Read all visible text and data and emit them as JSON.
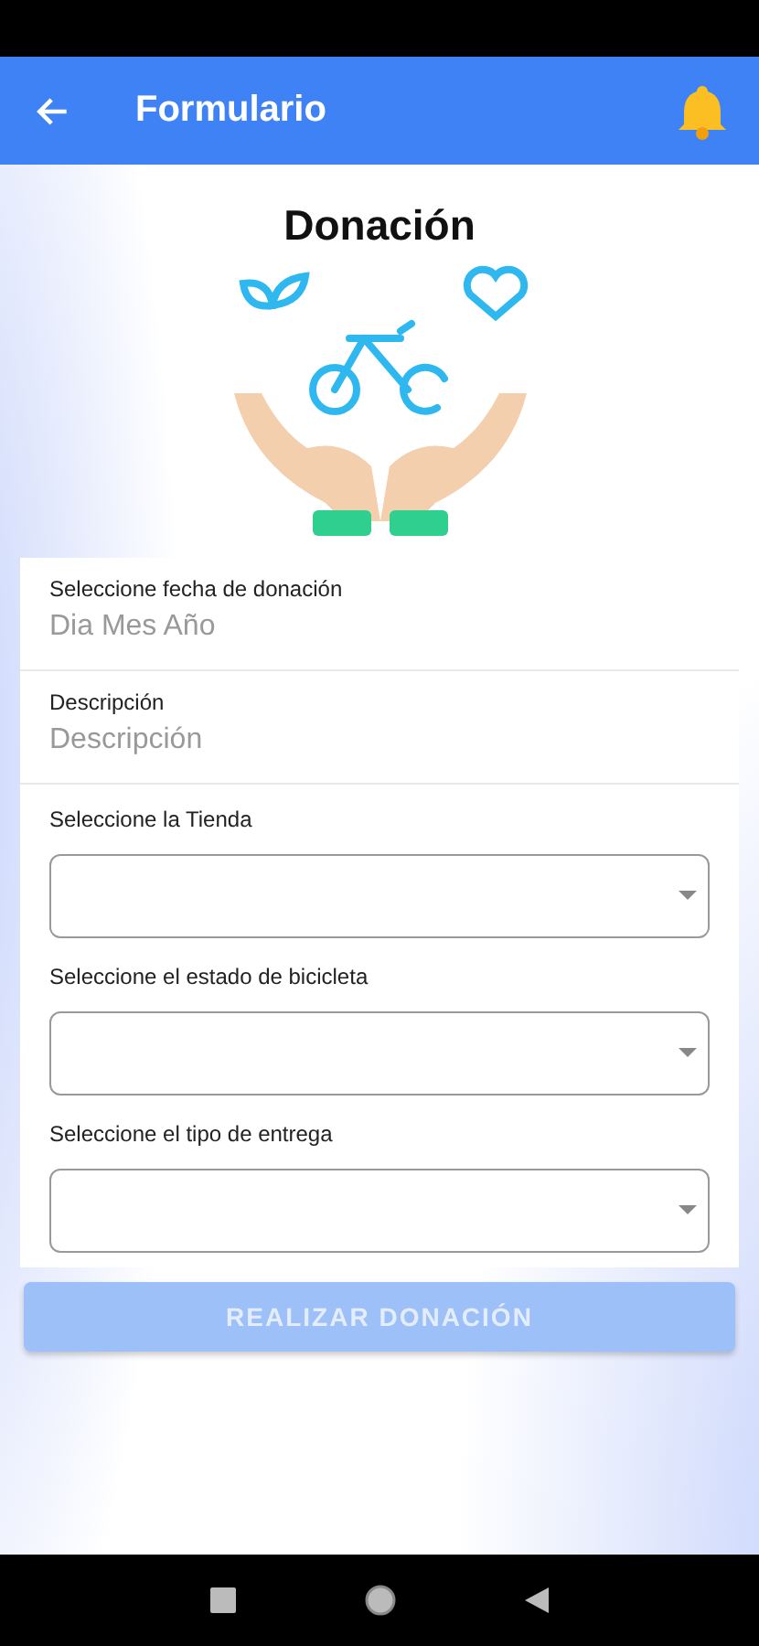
{
  "app_bar": {
    "title": "Formulario"
  },
  "heading": "Donación",
  "text_fields": [
    {
      "label": "Seleccione fecha de donación",
      "placeholder": "Dia Mes Año"
    },
    {
      "label": "Descripción",
      "placeholder": "Descripción"
    }
  ],
  "selects": [
    {
      "label": "Seleccione la Tienda"
    },
    {
      "label": "Seleccione el estado de bicicleta"
    },
    {
      "label": "Seleccione el tipo de entrega"
    }
  ],
  "submit": {
    "label": "REALIZAR DONACIÓN",
    "disabled": true
  }
}
